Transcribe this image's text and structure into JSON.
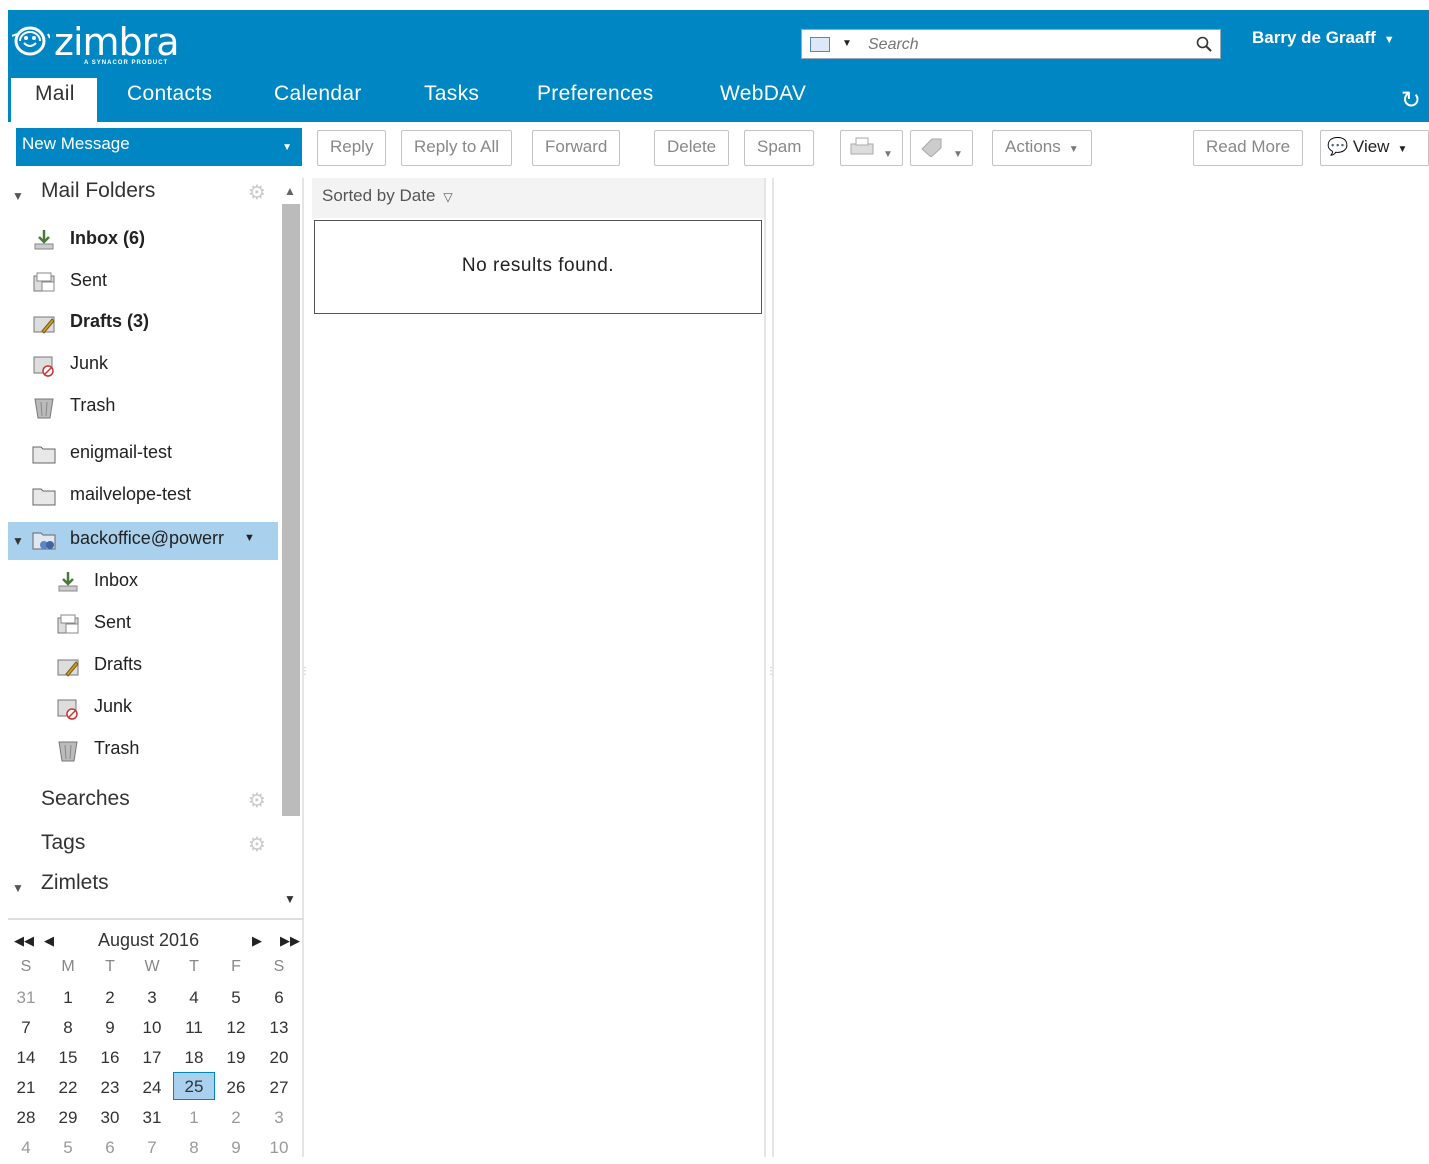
{
  "colors": {
    "accent": "#0087c3",
    "selected": "#a9d1ee"
  },
  "header": {
    "logo_text": "zimbra",
    "logo_sub": "A SYNACOR PRODUCT",
    "search_placeholder": "Search",
    "user_name": "Barry de Graaff",
    "refresh_icon": "refresh-icon"
  },
  "apptabs": [
    "Mail",
    "Contacts",
    "Calendar",
    "Tasks",
    "Preferences",
    "WebDAV"
  ],
  "toolbar": {
    "new_message": "New Message",
    "reply": "Reply",
    "reply_all": "Reply to All",
    "forward": "Forward",
    "delete": "Delete",
    "spam": "Spam",
    "actions": "Actions",
    "read_more": "Read More",
    "view": "View"
  },
  "sidebar": {
    "mail_folders": "Mail Folders",
    "folders": [
      {
        "label": "Inbox (6)",
        "icon": "inbox-icon"
      },
      {
        "label": "Sent",
        "icon": "sent-icon"
      },
      {
        "label": "Drafts (3)",
        "icon": "drafts-icon"
      },
      {
        "label": "Junk",
        "icon": "junk-icon"
      },
      {
        "label": "Trash",
        "icon": "trash-icon"
      },
      {
        "label": "enigmail-test",
        "icon": "folder-icon"
      },
      {
        "label": "mailvelope-test",
        "icon": "folder-icon"
      }
    ],
    "shared_account": "backoffice@powerr",
    "shared_folders": [
      {
        "label": "Inbox",
        "icon": "inbox-icon"
      },
      {
        "label": "Sent",
        "icon": "sent-icon"
      },
      {
        "label": "Drafts",
        "icon": "drafts-icon"
      },
      {
        "label": "Junk",
        "icon": "junk-icon"
      },
      {
        "label": "Trash",
        "icon": "trash-icon"
      }
    ],
    "searches": "Searches",
    "tags": "Tags",
    "zimlets": "Zimlets"
  },
  "calendar": {
    "title": "August 2016",
    "dow": [
      "S",
      "M",
      "T",
      "W",
      "T",
      "F",
      "S"
    ],
    "weeks": [
      [
        "31",
        "1",
        "2",
        "3",
        "4",
        "5",
        "6"
      ],
      [
        "7",
        "8",
        "9",
        "10",
        "11",
        "12",
        "13"
      ],
      [
        "14",
        "15",
        "16",
        "17",
        "18",
        "19",
        "20"
      ],
      [
        "21",
        "22",
        "23",
        "24",
        "25",
        "26",
        "27"
      ],
      [
        "28",
        "29",
        "30",
        "31",
        "1",
        "2",
        "3"
      ],
      [
        "4",
        "5",
        "6",
        "7",
        "8",
        "9",
        "10"
      ]
    ],
    "today": "25"
  },
  "list": {
    "sort_label": "Sorted by Date",
    "empty_text": "No results found."
  }
}
